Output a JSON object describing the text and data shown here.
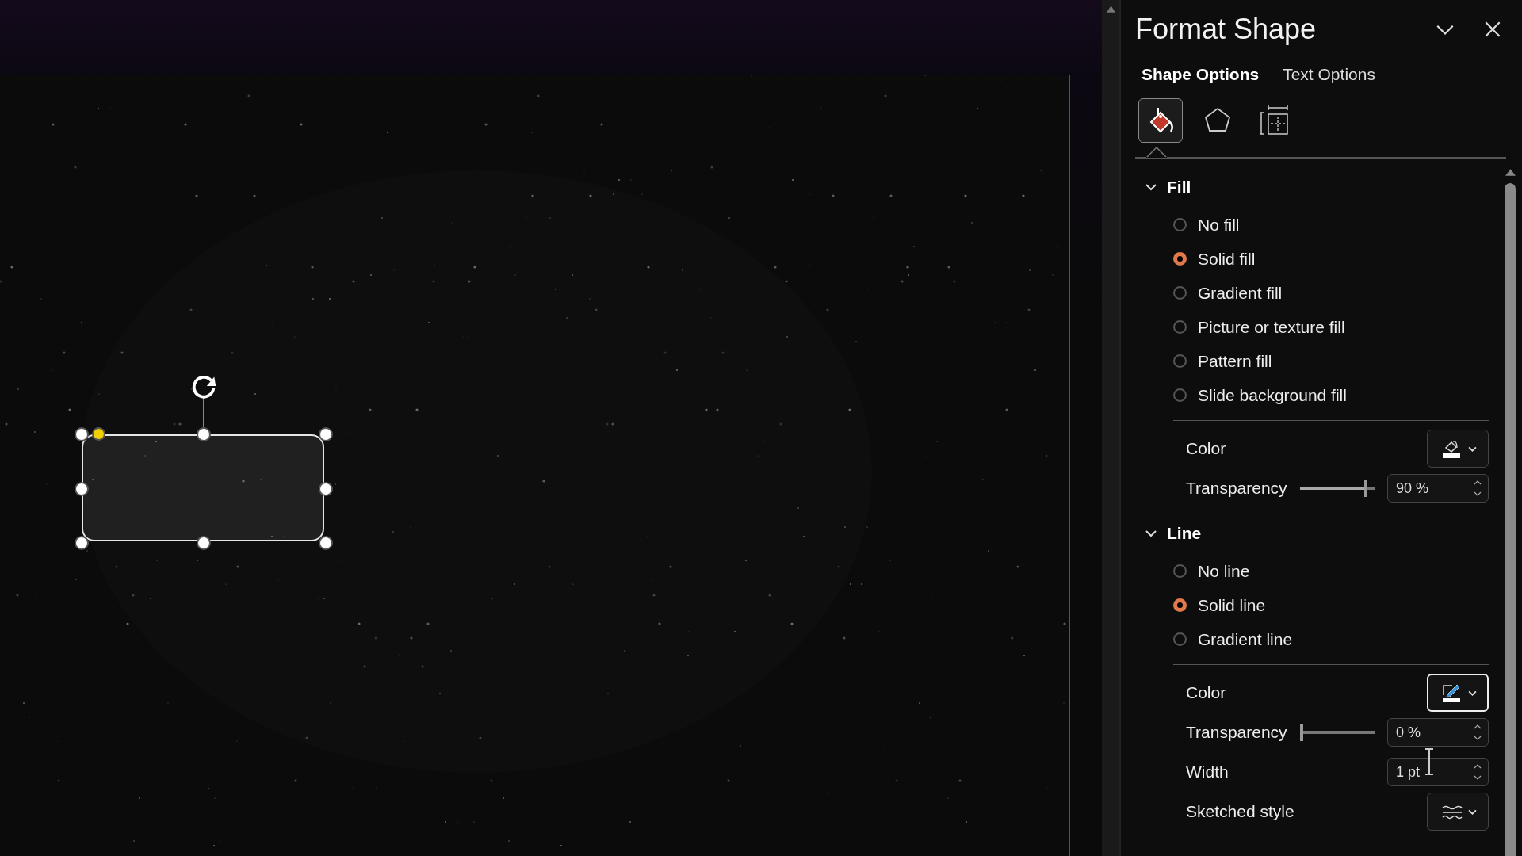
{
  "slide": {
    "shape": {
      "selected": true
    }
  },
  "panel": {
    "title": "Format Shape"
  },
  "tabs": [
    {
      "label": "Shape Options",
      "selected": true
    },
    {
      "label": "Text Options",
      "selected": false
    }
  ],
  "icon_tabs": [
    {
      "kind": "fill",
      "selected": true
    },
    {
      "kind": "effects",
      "selected": false
    },
    {
      "kind": "size",
      "selected": false
    }
  ],
  "sections": [
    {
      "title": "Fill",
      "expanded": true,
      "options": [
        {
          "label": "No fill",
          "selected": false
        },
        {
          "label": "Solid fill",
          "selected": true
        },
        {
          "label": "Gradient fill",
          "selected": false
        },
        {
          "label": "Picture or texture fill",
          "selected": false
        },
        {
          "label": "Pattern fill",
          "selected": false
        },
        {
          "label": "Slide background fill",
          "selected": false
        }
      ],
      "settings": [
        {
          "kind": "color",
          "label": "Color",
          "focused": false
        },
        {
          "kind": "slider",
          "label": "Transparency",
          "level": 0.9,
          "value": "90 %"
        }
      ]
    },
    {
      "title": "Line",
      "expanded": true,
      "options": [
        {
          "label": "No line",
          "selected": false
        },
        {
          "label": "Solid line",
          "selected": true
        },
        {
          "label": "Gradient line",
          "selected": false
        }
      ],
      "settings": [
        {
          "kind": "color",
          "label": "Color",
          "focused": true
        },
        {
          "kind": "slider",
          "label": "Transparency",
          "level": 0,
          "value": "0 %"
        },
        {
          "kind": "spin",
          "label": "Width",
          "value": "1 pt"
        },
        {
          "kind": "style",
          "label": "Sketched style"
        }
      ]
    }
  ]
}
